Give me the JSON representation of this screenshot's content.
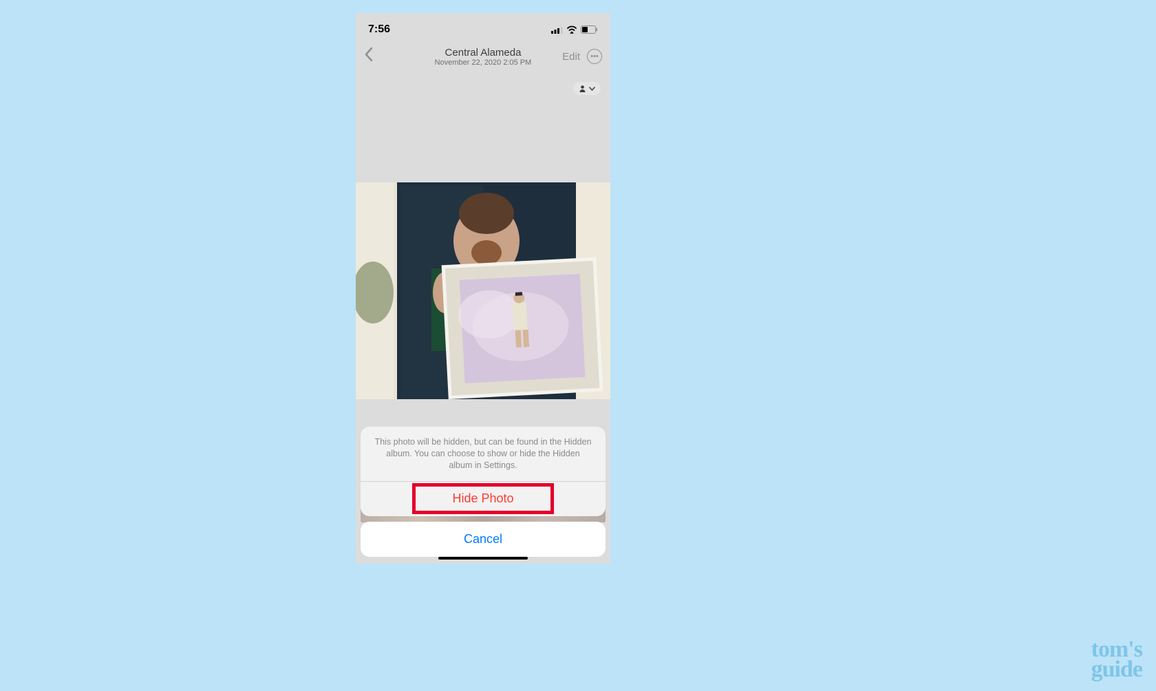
{
  "status": {
    "time": "7:56"
  },
  "nav": {
    "title": "Central Alameda",
    "subtitle": "November 22, 2020  2:05 PM",
    "edit_label": "Edit"
  },
  "sheet": {
    "message": "This photo will be hidden, but can be found in the Hidden album. You can choose to show or hide the Hidden album in Settings.",
    "hide_label": "Hide Photo",
    "cancel_label": "Cancel"
  },
  "watermark": {
    "line1": "tom's",
    "line2": "guide"
  }
}
